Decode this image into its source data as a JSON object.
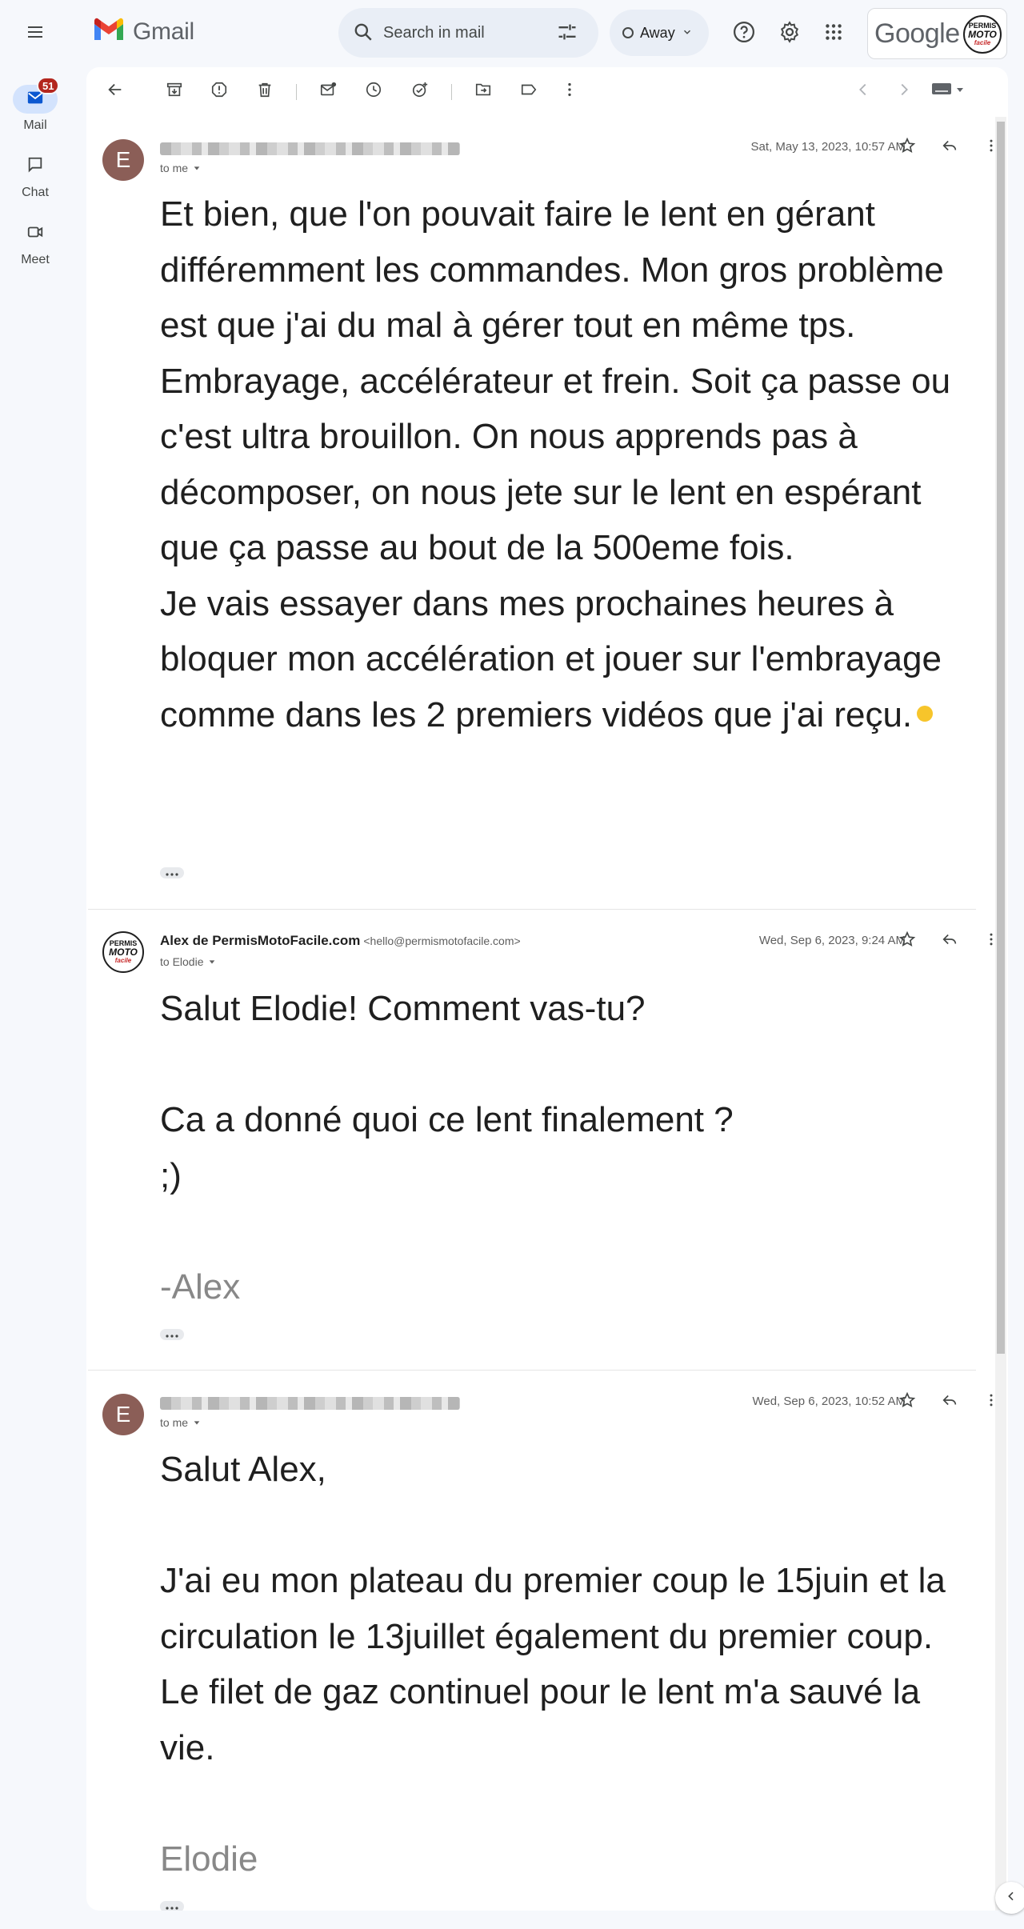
{
  "app": {
    "logo_text": "Gmail",
    "google_text": "Google"
  },
  "search": {
    "placeholder": "Search in mail"
  },
  "status": {
    "label": "Away"
  },
  "account": {
    "avatar_top": "PERMIS",
    "avatar_mid": "MOTO",
    "avatar_bottom": "facile"
  },
  "rail": {
    "mail": {
      "label": "Mail",
      "badge": "51"
    },
    "chat": {
      "label": "Chat"
    },
    "meet": {
      "label": "Meet"
    }
  },
  "toolbar": {
    "icons": [
      "back-arrow-icon",
      "archive-icon",
      "report-spam-icon",
      "delete-icon",
      "mark-unread-icon",
      "snooze-icon",
      "add-task-icon",
      "move-to-icon",
      "label-icon",
      "more-vert-icon",
      "newer-icon",
      "older-icon",
      "keyboard-icon"
    ]
  },
  "messages": [
    {
      "avatar_letter": "E",
      "to": "to me",
      "date": "Sat, May 13, 2023, 10:57 AM",
      "paragraphs": [
        "Et bien, que l'on pouvait faire le lent en gérant différemment les commandes. Mon gros problème est que j'ai du mal à gérer tout en même tps. Embrayage, accélérateur et frein. Soit ça passe ou c'est ultra brouillon. On nous apprends pas à décomposer, on nous jete sur le lent en espérant que ça passe au bout de la 500eme fois.",
        "Je vais essayer dans mes prochaines heures à bloquer mon accélération et jouer sur l'embrayage comme dans les 2 premiers vidéos que j'ai reçu."
      ]
    },
    {
      "sender_name": "Alex de PermisMotoFacile.com",
      "sender_email": "<hello@permismotofacile.com>",
      "to": "to Elodie",
      "date": "Wed, Sep 6, 2023, 9:24 AM",
      "avatar_top": "PERMIS",
      "avatar_mid": "MOTO",
      "avatar_bottom": "facile",
      "paragraphs": [
        "Salut Elodie! Comment vas-tu?",
        "",
        "Ca a donné quoi ce lent finalement ?",
        ";)",
        ""
      ],
      "signature": "-Alex"
    },
    {
      "avatar_letter": "E",
      "to": "to me",
      "date": "Wed, Sep 6, 2023, 10:52 AM",
      "paragraphs": [
        "Salut Alex,",
        "",
        "J'ai eu mon plateau du premier coup le 15juin et la circulation le 13juillet également du premier coup. Le filet de gaz continuel pour le lent m'a sauvé la vie.",
        ""
      ],
      "signature": "Elodie"
    }
  ]
}
